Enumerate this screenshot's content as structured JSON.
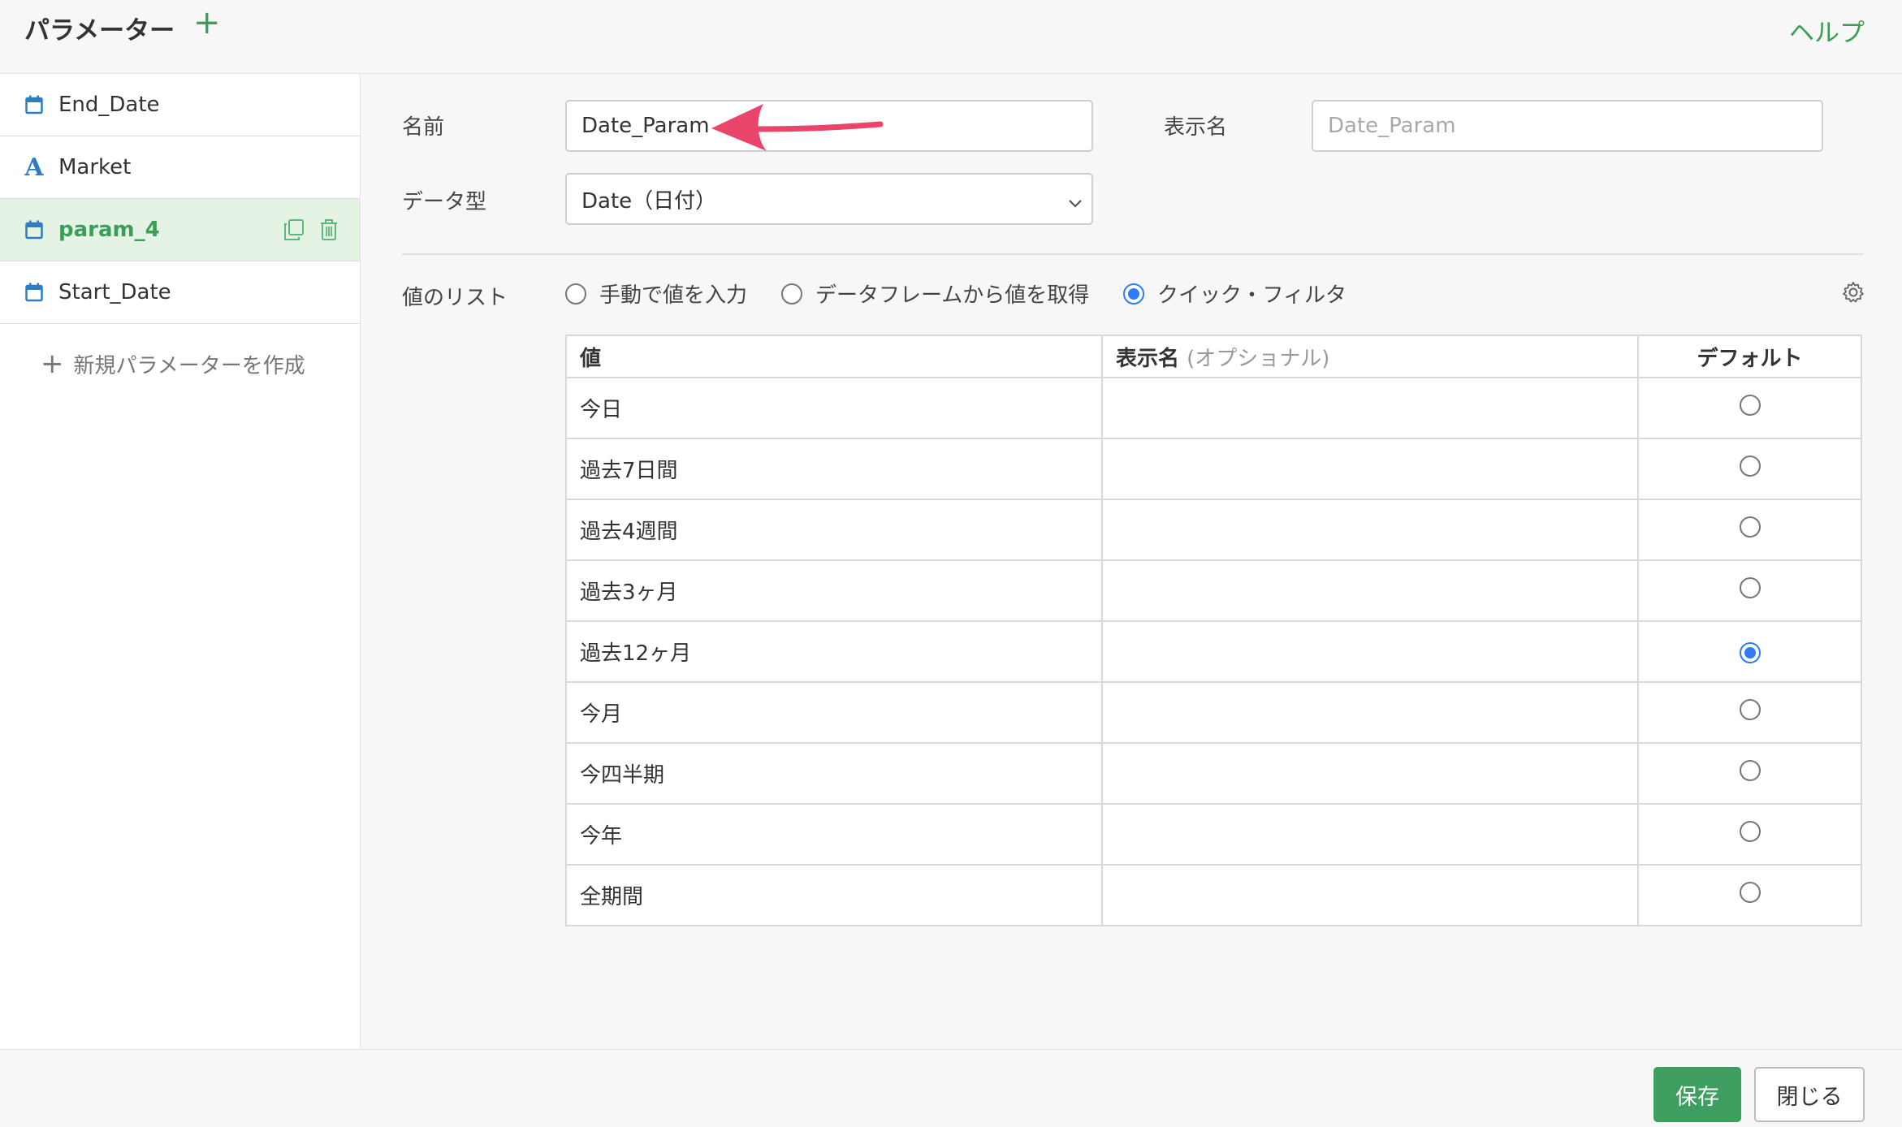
{
  "header": {
    "title": "パラメーター",
    "add_icon": "plus-icon",
    "help": "ヘルプ"
  },
  "sidebar": {
    "items": [
      {
        "label": "End_Date",
        "icon": "calendar-icon",
        "active": false
      },
      {
        "label": "Market",
        "icon": "text-type-icon",
        "active": false
      },
      {
        "label": "param_4",
        "icon": "calendar-icon",
        "active": true
      },
      {
        "label": "Start_Date",
        "icon": "calendar-icon",
        "active": false
      }
    ],
    "new_label": "新規パラメーターを作成"
  },
  "form": {
    "name_label": "名前",
    "name_value": "Date_Param",
    "display_label": "表示名",
    "display_placeholder": "Date_Param",
    "type_label": "データ型",
    "type_value": "Date（日付）",
    "list_label": "値のリスト",
    "list_options": [
      "手動で値を入力",
      "データフレームから値を取得",
      "クイック・フィルタ"
    ],
    "list_selected": 2
  },
  "table": {
    "col_value": "値",
    "col_display": "表示名",
    "col_display_hint": "(オプショナル)",
    "col_default": "デフォルト",
    "rows": [
      {
        "value": "今日",
        "display": "",
        "default": false
      },
      {
        "value": "過去7日間",
        "display": "",
        "default": false
      },
      {
        "value": "過去4週間",
        "display": "",
        "default": false
      },
      {
        "value": "過去3ヶ月",
        "display": "",
        "default": false
      },
      {
        "value": "過去12ヶ月",
        "display": "",
        "default": true
      },
      {
        "value": "今月",
        "display": "",
        "default": false
      },
      {
        "value": "今四半期",
        "display": "",
        "default": false
      },
      {
        "value": "今年",
        "display": "",
        "default": false
      },
      {
        "value": "全期間",
        "display": "",
        "default": false
      }
    ]
  },
  "footer": {
    "save": "保存",
    "close": "閉じる"
  },
  "colors": {
    "accent": "#3a9e5a",
    "radio": "#2e7df6",
    "active_bg": "#e4f3e4",
    "arrow": "#e9446a"
  }
}
